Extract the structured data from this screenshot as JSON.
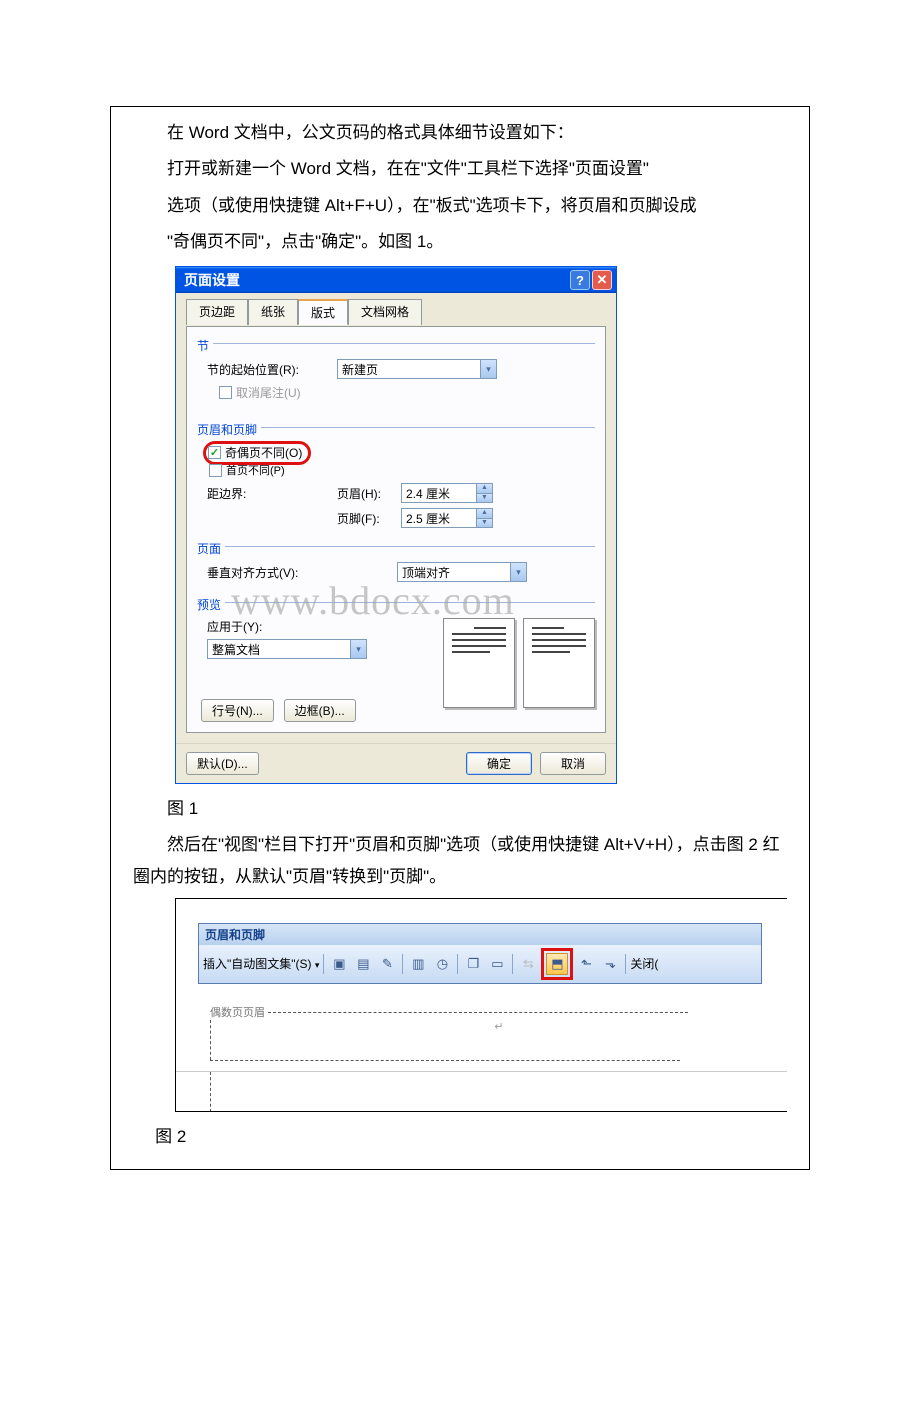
{
  "paragraphs": {
    "p1": "在 Word 文档中，公文页码的格式具体细节设置如下：",
    "p2": "打开或新建一个 Word 文档，在在\"文件\"工具栏下选择\"页面设置\"",
    "p3": "选项（或使用快捷键 Alt+F+U），在\"板式\"选项卡下，将页眉和页脚设成",
    "p4": "\"奇偶页不同\"，点击\"确定\"。如图 1。",
    "p5": "然后在\"视图\"栏目下打开\"页眉和页脚\"选项（或使用快捷键 Alt+V+H），点击图 2 红圈内的按钮，从默认\"页眉\"转换到\"页脚\"。"
  },
  "captions": {
    "fig1": "图 1",
    "fig2": "图 2"
  },
  "watermark": "www.bdocx.com",
  "dialog": {
    "title": "页面设置",
    "tabs": {
      "margins": "页边距",
      "paper": "纸张",
      "layout": "版式",
      "grid": "文档网格"
    },
    "sectionGroup": "节",
    "sectionStartLabel": "节的起始位置(R):",
    "sectionStartValue": "新建页",
    "suppressEndnotes": "取消尾注(U)",
    "headerFooterGroup": "页眉和页脚",
    "diffOddEven": "奇偶页不同(O)",
    "diffFirstPage": "首页不同(P)",
    "fromEdge": "距边界:",
    "headerLabel": "页眉(H):",
    "headerValue": "2.4 厘米",
    "footerLabel": "页脚(F):",
    "footerValue": "2.5 厘米",
    "pageGroup": "页面",
    "vAlignLabel": "垂直对齐方式(V):",
    "vAlignValue": "顶端对齐",
    "previewGroup": "预览",
    "applyToLabel": "应用于(Y):",
    "applyToValue": "整篇文档",
    "lineNumBtn": "行号(N)...",
    "borderBtn": "边框(B)...",
    "defaultBtn": "默认(D)...",
    "okBtn": "确定",
    "cancelBtn": "取消"
  },
  "hfToolbar": {
    "title": "页眉和页脚",
    "autotext": "插入\"自动图文集\"(S)",
    "close": "关闭(",
    "evenHeaderLabel": "偶数页页眉"
  }
}
